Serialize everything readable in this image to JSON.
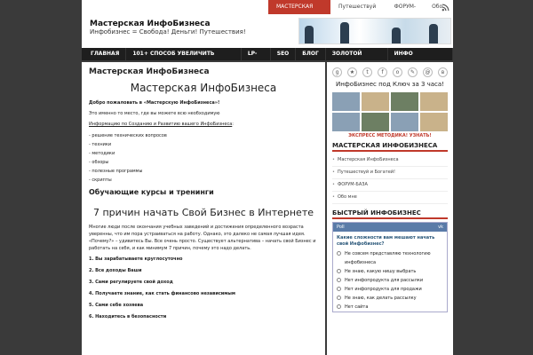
{
  "topnav": {
    "items": [
      "МАСТЕРСКАЯ ИНФОБИЗНЕСА",
      "Путешествуй и Богатей!",
      "ФОРУМ-БАЗА",
      "Обо мне"
    ]
  },
  "site": {
    "title": "Мастерская ИнфоБизнеса",
    "description": "Инфобизнес = Свобода! Деньги! Путешествия!"
  },
  "mainnav": {
    "items": [
      "ГЛАВНАЯ",
      "101+ СПОСОБ УВЕЛИЧИТЬ ТРАФИК",
      "LP-SP",
      "SEO",
      "БЛОГ",
      "ЗОЛОТОЙ АКТИВ",
      "ИНФО ПРОДУКТЫ"
    ]
  },
  "content": {
    "page_title": "Мастерская ИнфоБизнеса",
    "big_title": "Мастерская ИнфоБизнеса",
    "welcome": "Добро пожаловать в «Мастерскую ИнфоБизнеса»!",
    "place": "Это именно то место, где вы можете  всю необходимую",
    "info_link": "Информацию по Созданию и Развитию вашего ИнфоБизнеса",
    "info_colon": ":",
    "list": [
      "- решение технических вопросов",
      "- техники",
      "- методики",
      "- обзоры",
      "- полезные программы",
      "- скрипты"
    ],
    "courses_heading": "Обучающие курсы и тренинги",
    "seven_title": "7 причин начать Свой Бизнес в Интернете",
    "intro": "Многие люди после окончания учебных заведений и достижения определенного возраста уверенны, что им пора устраиваться на работу. Однако, это далеко не самая лучшая идея. «Почему?» – удивитесь Вы. Все очень просто. Существует альтернатива – начать свой Бизнес и работать на себя, и как минимум 7 причин, почему это надо делать.",
    "reasons": [
      "1. Вы зарабатываете круглосуточно",
      "2. Все доходы Ваши",
      "3. Сами регулируете свой доход",
      "4. Получаете знание, как стать финансово независимым",
      "5. Сами себе хозяева",
      "6. Находитесь в безопасности"
    ]
  },
  "sidebar": {
    "caption": "ИнфоБизнес под Ключ за 3 часа!",
    "express": "ЭКСПРЕСС МЕТОДИКА! УЗНАТЬ!",
    "widget1_title": "МАСТЕРСКАЯ ИНФОБИЗНЕСА",
    "widget1_items": [
      "Мастерская ИнфоБизнеса",
      "Путешествуй и Богатей!",
      "ФОРУМ-БАЗА",
      "Обо мне"
    ],
    "widget2_title": "БЫСТРЫЙ ИНФОБИЗНЕС",
    "poll": {
      "header": "Poll",
      "vk": "vk",
      "question": "Какие сложности вам мешают начать свой Инфобизнес?",
      "options": [
        "Не совсем представляю технологию инфобизнеса",
        "Не знаю, какую нишу выбрать",
        "Нет инфопродукта для рассылки",
        "Нет инфопродукта для продажи",
        "Не знаю, как делать рассылку",
        "Нет сайта"
      ]
    }
  }
}
